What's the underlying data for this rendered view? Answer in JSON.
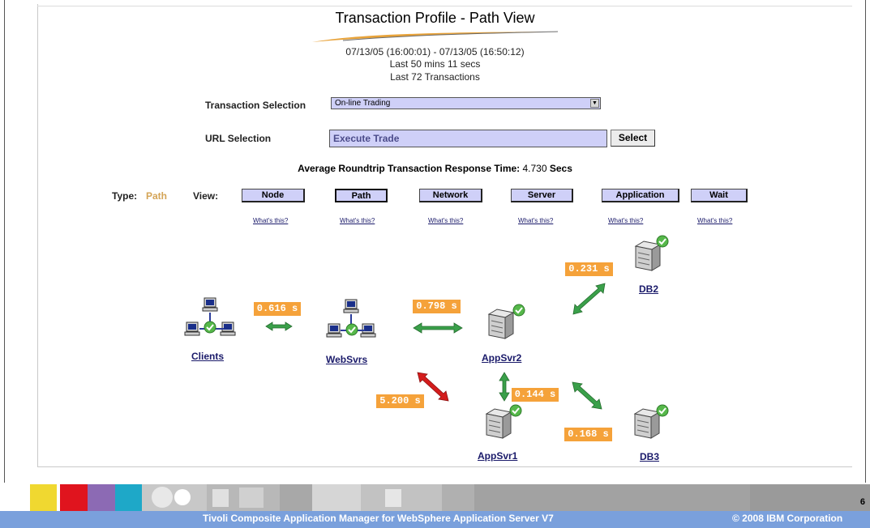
{
  "header": {
    "title": "Transaction Profile - Path View",
    "date_range": "07/13/05 (16:00:01) - 07/13/05 (16:50:12)",
    "last_mins": "Last 50 mins 11 secs",
    "last_transactions": "Last 72 Transactions"
  },
  "form": {
    "transaction_label": "Transaction Selection",
    "transaction_value": "On-line Trading",
    "url_label": "URL Selection",
    "url_value": "Execute Trade",
    "select_button": "Select"
  },
  "summary": {
    "avg_label": "Average Roundtrip Transaction Response Time:",
    "avg_value": "4.730",
    "avg_unit": "Secs"
  },
  "view_bar": {
    "type_label": "Type:",
    "type_value": "Path",
    "view_label": "View:",
    "buttons": [
      {
        "label": "Node",
        "help": "What's this?"
      },
      {
        "label": "Path",
        "help": "What's this?"
      },
      {
        "label": "Network",
        "help": "What's this?"
      },
      {
        "label": "Server",
        "help": "What's this?"
      },
      {
        "label": "Application",
        "help": "What's this?"
      },
      {
        "label": "Wait",
        "help": "What's this?"
      }
    ],
    "active": "Path"
  },
  "topology": {
    "nodes": [
      "Clients",
      "WebSvrs",
      "AppSvr2",
      "DB2",
      "AppSvr1",
      "DB3"
    ],
    "times": {
      "clients_websvrs": "0.616 s",
      "websvrs_appsvr2": "0.798 s",
      "appsvr2_db2": "0.231 s",
      "websvrs_appsvr1": "5.200 s",
      "appsvr2_appsvr1": "0.144 s",
      "appsvr2_db3": "0.168 s"
    }
  },
  "footer": {
    "product": "Tivoli Composite Application Manager for WebSphere Application Server V7",
    "copyright": "© 2008 IBM Corporation",
    "page": "6"
  },
  "colors": {
    "time_badge": "#f5a23a",
    "ok_arrow": "#3aa04a",
    "slow_arrow": "#d01a1a",
    "button_fill": "#cfd0f8",
    "footer_bar": "#7aa0dc"
  }
}
